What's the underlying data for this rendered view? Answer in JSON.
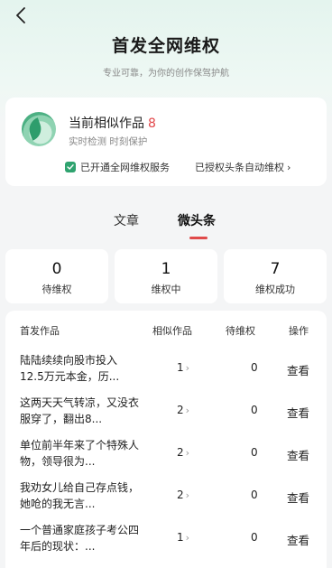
{
  "header": {
    "title": "首发全网维权",
    "subtitle": "专业可靠，为你的创作保驾护航"
  },
  "summary_card": {
    "title": "当前相似作品",
    "count": "8",
    "subtitle": "实时检测 时刻保护",
    "service_status": "已开通全网维权服务",
    "auto_protect": "已授权头条自动维权"
  },
  "tabs": [
    {
      "label": "文章"
    },
    {
      "label": "微头条"
    }
  ],
  "stats": [
    {
      "value": "0",
      "label": "待维权"
    },
    {
      "value": "1",
      "label": "维权中"
    },
    {
      "value": "7",
      "label": "维权成功"
    }
  ],
  "table": {
    "headers": {
      "work": "首发作品",
      "similar": "相似作品",
      "pending": "待维权",
      "action": "操作"
    },
    "rows": [
      {
        "title": "陆陆续续向股市投入12.5万元本金，历...",
        "similar": "1",
        "pending": "0",
        "action": "查看"
      },
      {
        "title": "这两天天气转凉，又没衣服穿了，翻出8...",
        "similar": "2",
        "pending": "0",
        "action": "查看"
      },
      {
        "title": "单位前半年来了个特殊人物，领导很为...",
        "similar": "2",
        "pending": "0",
        "action": "查看"
      },
      {
        "title": "我劝女儿给自己存点钱，她呛的我无言...",
        "similar": "2",
        "pending": "0",
        "action": "查看"
      },
      {
        "title": "一个普通家庭孩子考公四年后的现状：...",
        "similar": "1",
        "pending": "0",
        "action": "查看"
      }
    ]
  },
  "colors": {
    "accent_red": "#e04a4a",
    "brand_green": "#2fa36f"
  }
}
